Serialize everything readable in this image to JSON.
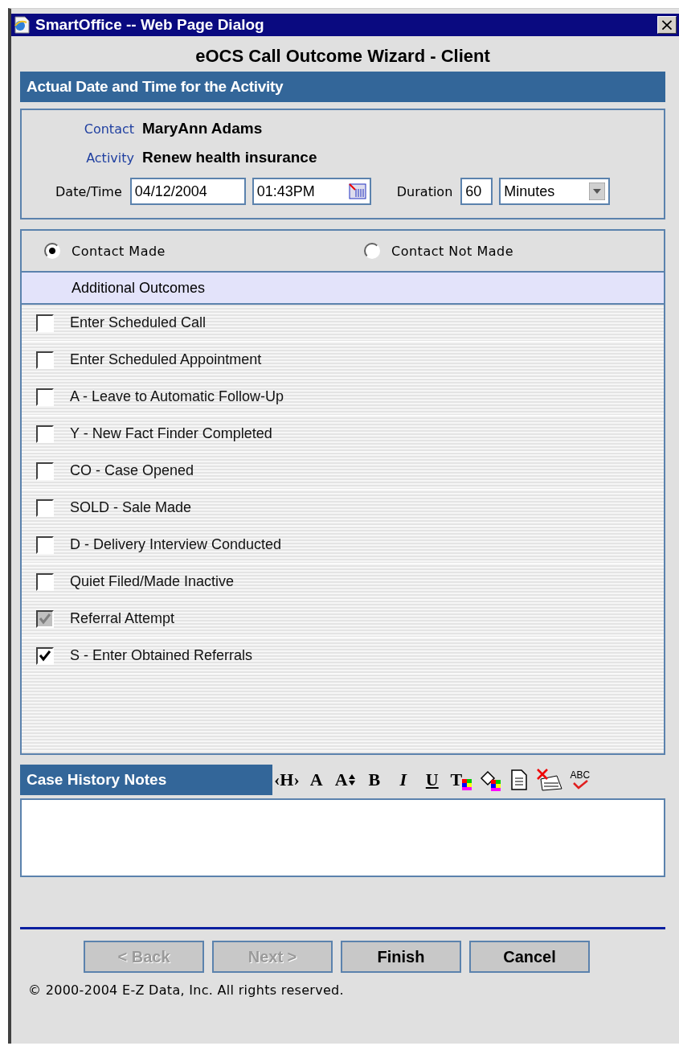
{
  "window": {
    "title": "SmartOffice -- Web Page Dialog",
    "close": "×"
  },
  "heading": "eOCS Call Outcome Wizard - Client",
  "activity_section": {
    "title": "Actual Date and Time for the Activity",
    "contact_label": "Contact",
    "contact": "MaryAnn Adams",
    "activity_label": "Activity",
    "activity": "Renew health insurance",
    "datetime_label": "Date/Time",
    "date": "04/12/2004",
    "time": "01:43PM",
    "duration_label": "Duration",
    "duration": "60",
    "duration_unit": "Minutes"
  },
  "contact_options": [
    {
      "label": "Contact Made",
      "selected": true
    },
    {
      "label": "Contact Not Made",
      "selected": false
    }
  ],
  "outcomes": {
    "title": "Additional Outcomes",
    "items": [
      {
        "label": "Enter Scheduled Call",
        "checked": false,
        "disabled": false
      },
      {
        "label": "Enter Scheduled Appointment",
        "checked": false,
        "disabled": false
      },
      {
        "label": "A - Leave to Automatic Follow-Up",
        "checked": false,
        "disabled": false
      },
      {
        "label": "Y - New Fact Finder Completed",
        "checked": false,
        "disabled": false
      },
      {
        "label": "CO - Case Opened",
        "checked": false,
        "disabled": false
      },
      {
        "label": "SOLD - Sale Made",
        "checked": false,
        "disabled": false
      },
      {
        "label": "D - Delivery Interview Conducted",
        "checked": false,
        "disabled": false
      },
      {
        "label": "Quiet Filed/Made Inactive",
        "checked": false,
        "disabled": false
      },
      {
        "label": "Referral Attempt",
        "checked": true,
        "disabled": true
      },
      {
        "label": "S - Enter Obtained Referrals",
        "checked": true,
        "disabled": false
      }
    ]
  },
  "notes": {
    "title": "Case History Notes",
    "toolbar": [
      {
        "kind": "text",
        "label": "‹H›"
      },
      {
        "kind": "text",
        "label": "A"
      },
      {
        "kind": "size",
        "label": "A"
      },
      {
        "kind": "bold",
        "label": "B"
      },
      {
        "kind": "italic",
        "label": "I"
      },
      {
        "kind": "underline",
        "label": "U"
      },
      {
        "kind": "color",
        "label": "T"
      },
      {
        "kind": "fill"
      },
      {
        "kind": "page"
      },
      {
        "kind": "clear"
      },
      {
        "kind": "spell",
        "label": "ABC"
      }
    ]
  },
  "buttons": [
    {
      "label": "< Back",
      "disabled": true
    },
    {
      "label": "Next >",
      "disabled": true
    },
    {
      "label": "Finish",
      "disabled": false
    },
    {
      "label": "Cancel",
      "disabled": false
    }
  ],
  "footer": "© 2000-2004 E-Z Data, Inc. All rights reserved."
}
